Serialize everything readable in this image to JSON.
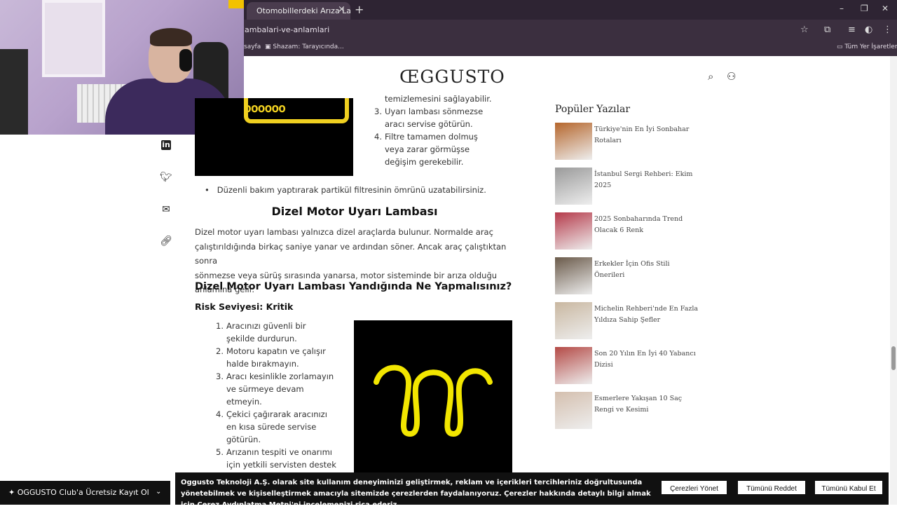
{
  "browser": {
    "tab_title": "Otomobillerdeki Arıza Lambala",
    "tab_close": "×",
    "new_tab": "+",
    "url": "lambalari-ve-anlamlari",
    "bookmarks": [
      "sayfa",
      "Shazam: Tarayıcında..."
    ],
    "all_bookmarks": "Tüm Yer İşaretleri",
    "window_controls": [
      "–",
      "❐",
      "✕"
    ]
  },
  "site": {
    "logo": "ŒGGUSTO",
    "icons": [
      "search-icon",
      "user-icon"
    ]
  },
  "share_icons": [
    "linkedin-icon",
    "twitter-icon",
    "mail-icon",
    "link-icon"
  ],
  "article": {
    "top_list": [
      {
        "n": "",
        "text": "temizlemesini sağlayabilir."
      },
      {
        "n": "3.",
        "text": "Uyarı lambası sönmezse"
      },
      {
        "n": "",
        "text": "aracı servise götürün."
      },
      {
        "n": "4.",
        "text": "Filtre tamamen dolmuş"
      },
      {
        "n": "",
        "text": "veya zarar görmüşse"
      },
      {
        "n": "",
        "text": "değişim gerekebilir."
      }
    ],
    "bullet": "Düzenli bakım yaptırarak partikül filtresinin ömrünü uzatabilirsiniz.",
    "h2": "Dizel Motor Uyarı Lambası",
    "para_lines": [
      "Dizel motor uyarı lambası yalnızca dizel araçlarda bulunur. Normalde araç",
      "çalıştırıldığında birkaç saniye yanar ve ardından söner. Ancak araç çalıştıktan sonra",
      "sönmezse veya sürüş sırasında yanarsa, motor sisteminde bir arıza olduğu anlamına gelir."
    ],
    "h3": "Dizel Motor Uyarı Lambası Yandığında Ne Yapmalısınız?",
    "h4": "Risk Seviyesi: Kritik",
    "steps": [
      {
        "n": "1.",
        "text": "Aracınızı güvenli bir"
      },
      {
        "n": "",
        "text": "şekilde durdurun."
      },
      {
        "n": "2.",
        "text": "Motoru kapatın ve çalışır"
      },
      {
        "n": "",
        "text": "halde bırakmayın."
      },
      {
        "n": "3.",
        "text": "Aracı kesinlikle zorlamayın"
      },
      {
        "n": "",
        "text": "ve sürmeye devam"
      },
      {
        "n": "",
        "text": "etmeyin."
      },
      {
        "n": "4.",
        "text": "Çekici çağırarak aracınızı"
      },
      {
        "n": "",
        "text": "en kısa sürede servise"
      },
      {
        "n": "",
        "text": "götürün."
      },
      {
        "n": "5.",
        "text": "Arızanın tespiti ve onarımı"
      },
      {
        "n": "",
        "text": "için yetkili servisten destek"
      }
    ],
    "glow_color": "#f2e600"
  },
  "sidebar": {
    "title": "Popüler Yazılar",
    "posts": [
      {
        "title": "Türkiye'nin En İyi Sonbahar Rotaları",
        "color": "#b5662c"
      },
      {
        "title": "İstanbul Sergi Rehberi: Ekim 2025",
        "color": "#9a9a9a"
      },
      {
        "title": "2025 Sonbaharında Trend Olacak 6 Renk",
        "color": "#b53a4a"
      },
      {
        "title": "Erkekler İçin Ofis Stili Önerileri",
        "color": "#6a5a4a"
      },
      {
        "title": "Michelin Rehberi'nde En Fazla Yıldıza Sahip Şefler",
        "color": "#c9b7a0"
      },
      {
        "title": "Son 20 Yılın En İyi 40 Yabancı Dizisi",
        "color": "#b44a46"
      },
      {
        "title": "Esmerlere Yakışan 10 Saç Rengi ve Kesimi",
        "color": "#d4bfae"
      }
    ]
  },
  "club": {
    "label": "OGGUSTO Club'a Ücretsiz Kayıt Ol",
    "chevron": "⌄"
  },
  "cookie": {
    "text_before": "Oggusto Teknoloji A.Ş. olarak site kullanım deneyiminizi geliştirmek, reklam ve içerikleri tercihleriniz doğrultusunda yönetebilmek ve kişiselleştirmek amacıyla sitemizde çerezlerden faydalanıyoruz. Çerezler hakkında detaylı bilgi almak için ",
    "link": "Çerez Aydınlatma Metni",
    "text_after": "'ni incelemenizi rica ederiz.",
    "manage": "Çerezleri Yönet",
    "reject": "Tümünü Reddet",
    "accept": "Tümünü Kabul Et"
  }
}
